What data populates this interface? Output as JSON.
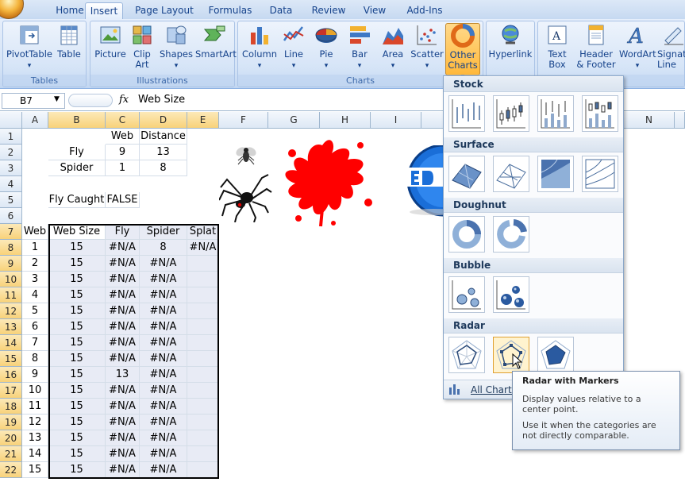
{
  "tabs": [
    "Home",
    "Insert",
    "Page Layout",
    "Formulas",
    "Data",
    "Review",
    "View",
    "Add-Ins"
  ],
  "active_tab": "Insert",
  "groups": {
    "tables": "Tables",
    "illustrations": "Illustrations",
    "charts": "Charts",
    "text": "Text"
  },
  "buttons": {
    "pivottable": "PivotTable",
    "table": "Table",
    "picture": "Picture",
    "clipart_1": "Clip",
    "clipart_2": "Art",
    "shapes": "Shapes",
    "smartart": "SmartArt",
    "column": "Column",
    "line": "Line",
    "pie": "Pie",
    "bar": "Bar",
    "area": "Area",
    "scatter": "Scatter",
    "other_1": "Other",
    "other_2": "Charts",
    "hyperlink": "Hyperlink",
    "textbox_1": "Text",
    "textbox_2": "Box",
    "header_1": "Header",
    "header_2": "& Footer",
    "wordart": "WordArt",
    "signature_1": "Signatu",
    "signature_2": "Line"
  },
  "formula_bar": {
    "name_box": "B7",
    "fx": "fx",
    "formula": "Web Size"
  },
  "columns": [
    "A",
    "B",
    "C",
    "D",
    "E",
    "F",
    "G",
    "H",
    "I",
    "M",
    "N"
  ],
  "rows": [
    "1",
    "2",
    "3",
    "4",
    "5",
    "6",
    "7",
    "8",
    "9",
    "10",
    "11",
    "12",
    "13",
    "14",
    "15",
    "16",
    "17",
    "18",
    "19",
    "20",
    "21",
    "22"
  ],
  "cells": {
    "c1": "Web",
    "d1": "Distance",
    "b2": "Fly",
    "c2": "9",
    "d2": "13",
    "b3": "Spider",
    "c3": "1",
    "d3": "8",
    "b5": "Fly Caught",
    "c5": "FALSE",
    "a7": "Web",
    "b7": "Web Size",
    "c7": "Fly",
    "d7": "Spider",
    "e7": "Splat",
    "table": [
      [
        "1",
        "15",
        "#N/A",
        "8",
        "#N/A"
      ],
      [
        "2",
        "15",
        "#N/A",
        "#N/A",
        ""
      ],
      [
        "3",
        "15",
        "#N/A",
        "#N/A",
        ""
      ],
      [
        "4",
        "15",
        "#N/A",
        "#N/A",
        ""
      ],
      [
        "5",
        "15",
        "#N/A",
        "#N/A",
        ""
      ],
      [
        "6",
        "15",
        "#N/A",
        "#N/A",
        ""
      ],
      [
        "7",
        "15",
        "#N/A",
        "#N/A",
        ""
      ],
      [
        "8",
        "15",
        "#N/A",
        "#N/A",
        ""
      ],
      [
        "9",
        "15",
        "13",
        "#N/A",
        ""
      ],
      [
        "10",
        "15",
        "#N/A",
        "#N/A",
        ""
      ],
      [
        "11",
        "15",
        "#N/A",
        "#N/A",
        ""
      ],
      [
        "12",
        "15",
        "#N/A",
        "#N/A",
        ""
      ],
      [
        "13",
        "15",
        "#N/A",
        "#N/A",
        ""
      ],
      [
        "14",
        "15",
        "#N/A",
        "#N/A",
        ""
      ],
      [
        "15",
        "15",
        "#N/A",
        "#N/A",
        ""
      ]
    ]
  },
  "dropdown": {
    "sections": [
      "Stock",
      "Surface",
      "Doughnut",
      "Bubble",
      "Radar"
    ],
    "footer": "All Chart T"
  },
  "tooltip": {
    "title": "Radar with Markers",
    "line1": "Display values relative to a center point.",
    "line2": "Use it when the categories are not directly comparable."
  },
  "colors": {
    "ribbon": "#d4e3f6",
    "accent": "#15428b",
    "splat": "#ff0000",
    "selection": "#e8ebf5"
  }
}
